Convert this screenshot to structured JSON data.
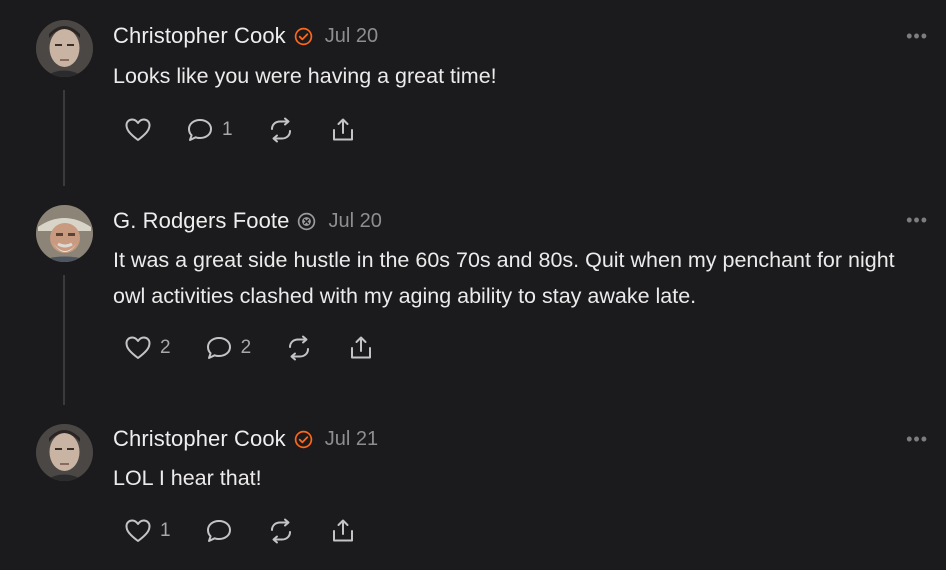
{
  "comments": [
    {
      "author": "Christopher Cook",
      "badge": "orange-check-badge",
      "date": "Jul 20",
      "text": "Looks like you were having a great time!",
      "likes": "",
      "replies": "1",
      "more": "•••"
    },
    {
      "author": "G. Rodgers Foote",
      "badge": "gray-x-badge",
      "date": "Jul 20",
      "text": "It was a great side hustle in the 60s 70s and 80s. Quit when my penchant for night owl activities clashed with my aging ability to stay awake late.",
      "likes": "2",
      "replies": "2",
      "more": "•••"
    },
    {
      "author": "Christopher Cook",
      "badge": "orange-check-badge",
      "date": "Jul 21",
      "text": "LOL I hear that!",
      "likes": "1",
      "replies": "",
      "more": "•••"
    }
  ],
  "colors": {
    "background": "#1b1b1d",
    "accent_badge": "#ff6719",
    "muted": "#8e8d90"
  }
}
